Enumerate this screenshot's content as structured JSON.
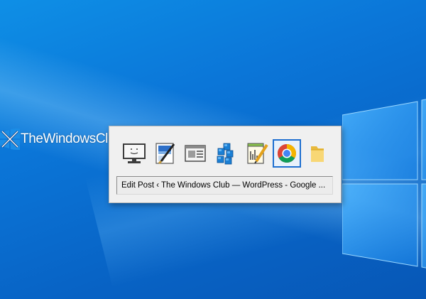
{
  "desktop": {
    "background_colors": [
      "#0e8fe6",
      "#0757b6"
    ]
  },
  "watermark": {
    "text": "TheWindowsClub",
    "icon": "windows-club-logo-icon"
  },
  "switcher": {
    "window_title": "Edit Post ‹ The Windows Club — WordPress - Google ...",
    "selected_index": 5,
    "selection_color": "#1e6fd0",
    "items": [
      {
        "icon": "monitor-icon"
      },
      {
        "icon": "paint-editor-icon"
      },
      {
        "icon": "document-window-icon"
      },
      {
        "icon": "registry-editor-icon"
      },
      {
        "icon": "notepad-plus-plus-icon"
      },
      {
        "icon": "chrome-icon"
      },
      {
        "icon": "folder-icon"
      }
    ]
  }
}
